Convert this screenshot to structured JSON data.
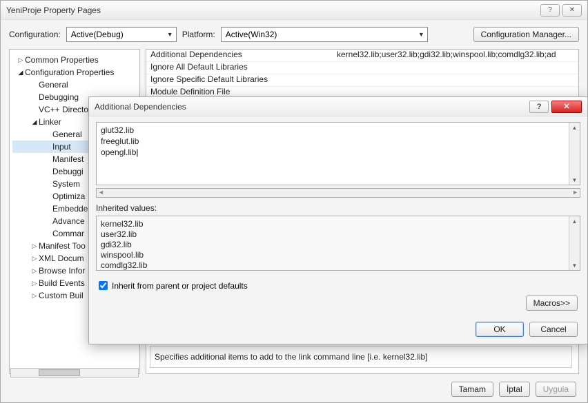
{
  "mainWindow": {
    "title": "YeniProje Property Pages",
    "configLabel": "Configuration:",
    "configValue": "Active(Debug)",
    "platformLabel": "Platform:",
    "platformValue": "Active(Win32)",
    "configManagerBtn": "Configuration Manager...",
    "applyBtn": "Uygula",
    "cancelBtn": "İptal",
    "okBtn": "Tamam",
    "description": "Specifies additional items to add to the link command line [i.e. kernel32.lib]"
  },
  "tree": {
    "items": [
      {
        "label": "Common Properties",
        "depth": 0,
        "arrow": "closed"
      },
      {
        "label": "Configuration Properties",
        "depth": 0,
        "arrow": "open"
      },
      {
        "label": "General",
        "depth": 1
      },
      {
        "label": "Debugging",
        "depth": 1
      },
      {
        "label": "VC++ Directo",
        "depth": 1
      },
      {
        "label": "Linker",
        "depth": 1,
        "arrow": "open"
      },
      {
        "label": "General",
        "depth": 2
      },
      {
        "label": "Input",
        "depth": 2,
        "selected": true
      },
      {
        "label": "Manifest",
        "depth": 2
      },
      {
        "label": "Debuggi",
        "depth": 2
      },
      {
        "label": "System",
        "depth": 2
      },
      {
        "label": "Optimiza",
        "depth": 2
      },
      {
        "label": "Embedde",
        "depth": 2
      },
      {
        "label": "Advance",
        "depth": 2
      },
      {
        "label": "Commar",
        "depth": 2
      },
      {
        "label": "Manifest Too",
        "depth": 1,
        "arrow": "closed"
      },
      {
        "label": "XML Docum",
        "depth": 1,
        "arrow": "closed"
      },
      {
        "label": "Browse Infor",
        "depth": 1,
        "arrow": "closed"
      },
      {
        "label": "Build Events",
        "depth": 1,
        "arrow": "closed"
      },
      {
        "label": "Custom Buil",
        "depth": 1,
        "arrow": "closed"
      }
    ]
  },
  "propGrid": {
    "rows": [
      {
        "name": "Additional Dependencies",
        "value": "kernel32.lib;user32.lib;gdi32.lib;winspool.lib;comdlg32.lib;ad"
      },
      {
        "name": "Ignore All Default Libraries",
        "value": ""
      },
      {
        "name": "Ignore Specific Default Libraries",
        "value": ""
      },
      {
        "name": "Module Definition File",
        "value": ""
      }
    ]
  },
  "modal": {
    "title": "Additional Dependencies",
    "editLines": [
      "glut32.lib",
      "freeglut.lib",
      "opengl.lib"
    ],
    "inheritedLabel": "Inherited values:",
    "inheritedLines": [
      "kernel32.lib",
      "user32.lib",
      "gdi32.lib",
      "winspool.lib",
      "comdlg32.lib"
    ],
    "inheritCheckbox": "Inherit from parent or project defaults",
    "macrosBtn": "Macros>>",
    "okBtn": "OK",
    "cancelBtn": "Cancel"
  }
}
